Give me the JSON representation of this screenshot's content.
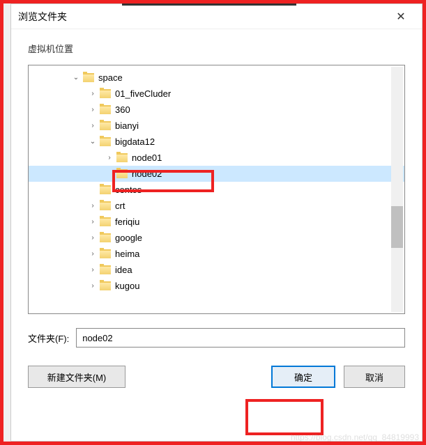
{
  "dialog": {
    "title": "浏览文件夹",
    "section_label": "虚拟机位置"
  },
  "tree": {
    "root": "space",
    "items": [
      {
        "name": "01_fiveCluder",
        "expanded": false,
        "depth": 1
      },
      {
        "name": "360",
        "expanded": false,
        "depth": 1
      },
      {
        "name": "bianyi",
        "expanded": false,
        "depth": 1
      },
      {
        "name": "bigdata12",
        "expanded": true,
        "depth": 1
      },
      {
        "name": "node01",
        "expanded": false,
        "depth": 2
      },
      {
        "name": "node02",
        "expanded": false,
        "depth": 2,
        "selected": true
      },
      {
        "name": "centos",
        "expanded": false,
        "depth": 1
      },
      {
        "name": "crt",
        "expanded": false,
        "depth": 1
      },
      {
        "name": "feriqiu",
        "expanded": false,
        "depth": 1
      },
      {
        "name": "google",
        "expanded": false,
        "depth": 1
      },
      {
        "name": "heima",
        "expanded": false,
        "depth": 1
      },
      {
        "name": "idea",
        "expanded": false,
        "depth": 1
      },
      {
        "name": "kugou",
        "expanded": false,
        "depth": 1
      }
    ]
  },
  "folder_field": {
    "label": "文件夹(F):",
    "value": "node02"
  },
  "buttons": {
    "new_folder": "新建文件夹(M)",
    "ok": "确定",
    "cancel": "取消"
  },
  "toggle": {
    "expanded": "⌄",
    "collapsed": "›"
  },
  "watermark": "https://blog.csdn.net/qq_84819993"
}
